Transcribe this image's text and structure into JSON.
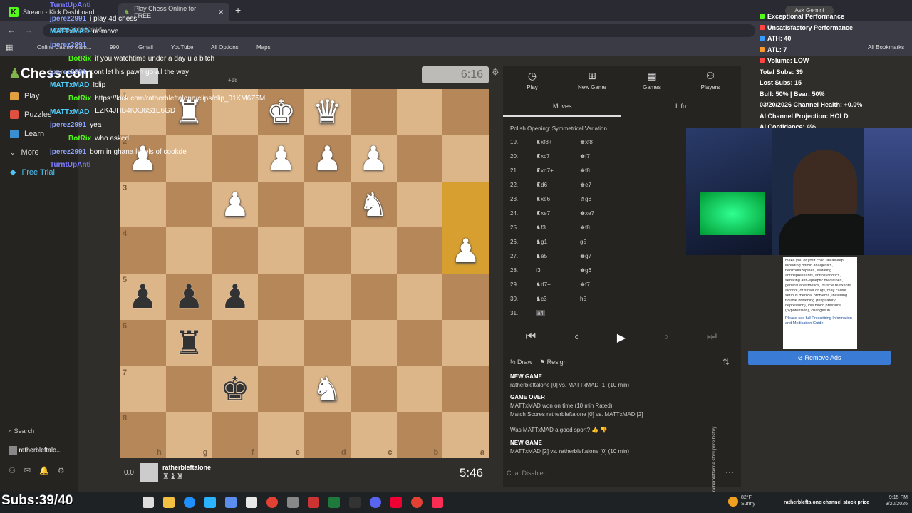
{
  "browser": {
    "tabs": [
      {
        "label": "Stream - Kick Dashboard"
      },
      {
        "label": "Play Chess Online for FREE"
      }
    ],
    "url": "...rd/6622008201б",
    "bookmarks": [
      "Online Casino Gam...",
      "990",
      "Gmail",
      "YouTube",
      "All Options",
      "Maps"
    ],
    "all_bookmarks": "All Bookmarks",
    "ask_gemini": "Ask Gemini"
  },
  "chess": {
    "logo": "Chess.com",
    "nav": [
      "Play",
      "Puzzles",
      "Learn",
      "More",
      "Free Trial"
    ],
    "bottom_nav": {
      "search": "Search",
      "user": "ratherbleftalo..."
    },
    "top_clock": "6:16",
    "bottom_clock": "5:46",
    "top_player_extra": "+18",
    "bottom_player": "ratherbleftalone",
    "bottom_score": "0.0",
    "ranks": [
      "1",
      "2",
      "3",
      "4",
      "5",
      "6",
      "7",
      "8"
    ],
    "files": [
      "h",
      "g",
      "f",
      "e",
      "d",
      "c",
      "b",
      "a"
    ],
    "pieces": [
      {
        "sq": "b1",
        "glyph": "♜",
        "color": "w"
      },
      {
        "sq": "d1",
        "glyph": "♚",
        "color": "w"
      },
      {
        "sq": "e1",
        "glyph": "♛",
        "color": "w"
      },
      {
        "sq": "a2",
        "glyph": "♟",
        "color": "w"
      },
      {
        "sq": "d2",
        "glyph": "♟",
        "color": "w"
      },
      {
        "sq": "e2",
        "glyph": "♟",
        "color": "w"
      },
      {
        "sq": "f2",
        "glyph": "♟",
        "color": "w"
      },
      {
        "sq": "c3",
        "glyph": "♟",
        "color": "w"
      },
      {
        "sq": "f3",
        "glyph": "♞",
        "color": "w"
      },
      {
        "sq": "h4",
        "glyph": "♟",
        "color": "w"
      },
      {
        "sq": "a5",
        "glyph": "♟",
        "color": "b"
      },
      {
        "sq": "b5",
        "glyph": "♟",
        "color": "b"
      },
      {
        "sq": "c5",
        "glyph": "♟",
        "color": "b"
      },
      {
        "sq": "b6",
        "glyph": "♜",
        "color": "b"
      },
      {
        "sq": "c7",
        "glyph": "♚",
        "color": "b"
      },
      {
        "sq": "e7",
        "glyph": "♞",
        "color": "w"
      }
    ],
    "highlights": [
      "h3",
      "h4"
    ],
    "panel_tabs": [
      "Play",
      "New Game",
      "Games",
      "Players"
    ],
    "sub_tabs": [
      "Moves",
      "Info"
    ],
    "opening": "Polish Opening: Symmetrical Variation",
    "moves": [
      {
        "n": "19.",
        "w": "♜xf8+",
        "b": "♚xf8"
      },
      {
        "n": "20.",
        "w": "♜xc7",
        "b": "♚f7"
      },
      {
        "n": "21.",
        "w": "♜xd7+",
        "b": "♚f8"
      },
      {
        "n": "22.",
        "w": "♜d6",
        "b": "♚e7"
      },
      {
        "n": "23.",
        "w": "♜xe6",
        "b": "♗g8"
      },
      {
        "n": "24.",
        "w": "♜xe7",
        "b": "♚xe7"
      },
      {
        "n": "25.",
        "w": "♞f3",
        "b": "♚f8"
      },
      {
        "n": "26.",
        "w": "♞g1",
        "b": "g5"
      },
      {
        "n": "27.",
        "w": "♞e5",
        "b": "♚g7"
      },
      {
        "n": "28.",
        "w": "f3",
        "b": "♚g6"
      },
      {
        "n": "29.",
        "w": "♞d7+",
        "b": "♚f7"
      },
      {
        "n": "30.",
        "w": "♞c3",
        "b": "h5"
      },
      {
        "n": "31.",
        "w": "a4",
        "b": ""
      }
    ],
    "draw": "Draw",
    "resign": "Resign",
    "log": {
      "new_game_1": "NEW GAME",
      "line1": "ratherbleftalone [0] vs. MATTxMAD [1] (10 min)",
      "game_over": "GAME OVER",
      "line2": "MATTxMAD won on time (10 min Rated)",
      "line3": "Match Scores ratherbleftalone [0] vs. MATTxMAD [2]",
      "sport": "Was MATTxMAD a good sport?",
      "new_game_2": "NEW GAME",
      "line4": "MATTxMAD [2] vs. ratherbleftalone [0] (10 min)"
    },
    "chat_disabled": "Chat Disabled"
  },
  "chat": [
    {
      "user": "TurntUpAnti",
      "text": "",
      "color": "#7b7cff"
    },
    {
      "user": "jperez2991",
      "text": "i play 4d chess",
      "color": "#8aa4ff"
    },
    {
      "user": "MATTxMAD",
      "text": "ur move",
      "color": "#4fd0ff"
    },
    {
      "user": "jperez2991",
      "text": "",
      "color": "#8aa4ff"
    },
    {
      "user": "BotRix",
      "text": "if you watchtime under a day u a bitch",
      "color": "#53fc18"
    },
    {
      "user": "jperez2991",
      "text": "dont let his pawn go all the way",
      "color": "#8aa4ff"
    },
    {
      "user": "MATTxMAD",
      "text": "!clip",
      "color": "#4fd0ff"
    },
    {
      "user": "BotRix",
      "text": "https://kick.com/ratherbleftalone/clips/clip_01KM6Z5MEZK4JHB4KXJ6S1E6GD",
      "color": "#53fc18"
    },
    {
      "user": "MATTxMAD",
      "text": "",
      "color": "#4fd0ff"
    },
    {
      "user": "jperez2991",
      "text": "yea",
      "color": "#8aa4ff"
    },
    {
      "user": "BotRix",
      "text": "who asked",
      "color": "#53fc18"
    },
    {
      "user": "jperez2991",
      "text": "born in ghana levels of cookde",
      "color": "#8aa4ff"
    },
    {
      "user": "TurntUpAnti",
      "text": "",
      "color": "#7b7cff"
    }
  ],
  "stats": [
    {
      "text": "Exceptional Performance",
      "color": "#53fc18"
    },
    {
      "text": "Unsatisfactory Performance",
      "color": "#ff4444"
    },
    {
      "text": "ATH: 40",
      "color": "#3a9bff"
    },
    {
      "text": "ATL: 7",
      "color": "#ff9a2a"
    },
    {
      "text": "Volume: LOW",
      "color": "#ff4444"
    },
    {
      "text": "Total Subs: 39",
      "color": ""
    },
    {
      "text": "Lost Subs: 15",
      "color": ""
    },
    {
      "text": "Bull: 50% | Bear: 50%",
      "color": ""
    },
    {
      "text": "03/20/2026 Channel Health: +0.0%",
      "color": ""
    },
    {
      "text": "AI Channel Projection: HOLD",
      "color": ""
    },
    {
      "text": "AI Confidence: 4%",
      "color": ""
    }
  ],
  "ad_text": "make you or your child fall asleep, including opioid analgesics, benzodiazepines, sedating antidepressants, antipsychotics, sedating anti-epileptic medicines, general anesthetics, muscle relaxants, alcohol, or street drugs, may cause serious medical problems, including trouble breathing (respiratory depression), low blood pressure (hypotension), changes in",
  "ad_footer": "Please see full Prescribing Information and Medication Guide",
  "remove_ads": "Remove Ads",
  "side_watermark": "ratherbleftalone stock price history",
  "subs_overlay": "Subs:39/40",
  "taskbar": {
    "weather_temp": "82°F",
    "weather": "Sunny",
    "time": "9:15 PM",
    "date": "3/20/2026",
    "ticker": "ratherbleftalone channel stock price"
  }
}
